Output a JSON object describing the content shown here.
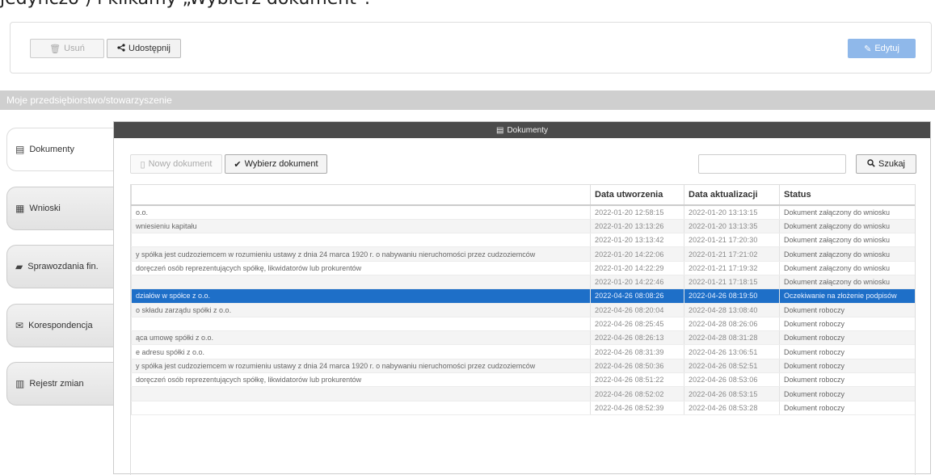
{
  "instruction_text": "jedynczo ) i klikamy „Wybierz dokument\".",
  "toolbar": {
    "delete_label": "Usuń",
    "share_label": "Udostępnij",
    "edit_label": "Edytuj"
  },
  "section_title": "Moje przedsiębiorstwo/stowarzyszenie",
  "sidebar": {
    "items": [
      {
        "label": "Dokumenty",
        "icon": "document-icon"
      },
      {
        "label": "Wnioski",
        "icon": "file-icon"
      },
      {
        "label": "Sprawozdania fin.",
        "icon": "folder-icon"
      },
      {
        "label": "Korespondencja",
        "icon": "envelope-icon"
      },
      {
        "label": "Rejestr zmian",
        "icon": "briefcase-icon"
      }
    ]
  },
  "documents_panel": {
    "title": "Dokumenty",
    "new_document_label": "Nowy dokument",
    "choose_document_label": "Wybierz dokument",
    "search_value": "",
    "search_button_label": "Szukaj"
  },
  "table": {
    "columns": [
      "",
      "Data utworzenia",
      "Data aktualizacji",
      "Status"
    ],
    "rows": [
      {
        "name": "o.o.",
        "created": "2022-01-20 12:58:15",
        "updated": "2022-01-20 13:13:15",
        "status": "Dokument załączony do wniosku"
      },
      {
        "name": "wniesieniu kapitału",
        "created": "2022-01-20 13:13:26",
        "updated": "2022-01-20 13:13:35",
        "status": "Dokument załączony do wniosku"
      },
      {
        "name": "",
        "created": "2022-01-20 13:13:42",
        "updated": "2022-01-21 17:20:30",
        "status": "Dokument załączony do wniosku"
      },
      {
        "name": "y spółka jest cudzoziemcem w rozumieniu ustawy z dnia 24 marca 1920 r. o nabywaniu nieruchomości przez cudzoziemców",
        "created": "2022-01-20 14:22:06",
        "updated": "2022-01-21 17:21:02",
        "status": "Dokument załączony do wniosku"
      },
      {
        "name": "doręczeń osób reprezentujących spółkę, likwidatorów lub prokurentów",
        "created": "2022-01-20 14:22:29",
        "updated": "2022-01-21 17:19:32",
        "status": "Dokument załączony do wniosku"
      },
      {
        "name": "",
        "created": "2022-01-20 14:22:46",
        "updated": "2022-01-21 17:18:15",
        "status": "Dokument załączony do wniosku"
      },
      {
        "name": "działów w spółce z o.o.",
        "created": "2022-04-26 08:08:26",
        "updated": "2022-04-26 08:19:50",
        "status": "Oczekiwanie na złożenie podpisów"
      },
      {
        "name": "o składu zarządu spółki z o.o.",
        "created": "2022-04-26 08:20:04",
        "updated": "2022-04-28 13:08:40",
        "status": "Dokument roboczy"
      },
      {
        "name": "",
        "created": "2022-04-26 08:25:45",
        "updated": "2022-04-28 08:26:06",
        "status": "Dokument roboczy"
      },
      {
        "name": "ąca umowę spółki z o.o.",
        "created": "2022-04-26 08:26:13",
        "updated": "2022-04-28 08:31:28",
        "status": "Dokument roboczy"
      },
      {
        "name": "e adresu spółki z o.o.",
        "created": "2022-04-26 08:31:39",
        "updated": "2022-04-26 13:06:51",
        "status": "Dokument roboczy"
      },
      {
        "name": "y spółka jest cudzoziemcem w rozumieniu ustawy z dnia 24 marca 1920 r. o nabywaniu nieruchomości przez cudzoziemców",
        "created": "2022-04-26 08:50:36",
        "updated": "2022-04-26 08:52:51",
        "status": "Dokument roboczy"
      },
      {
        "name": "doręczeń osób reprezentujących spółkę, likwidatorów lub prokurentów",
        "created": "2022-04-26 08:51:22",
        "updated": "2022-04-26 08:53:06",
        "status": "Dokument roboczy"
      },
      {
        "name": "",
        "created": "2022-04-26 08:52:02",
        "updated": "2022-04-26 08:53:15",
        "status": "Dokument roboczy"
      },
      {
        "name": "",
        "created": "2022-04-26 08:52:39",
        "updated": "2022-04-26 08:53:28",
        "status": "Dokument roboczy"
      }
    ],
    "selected_row": 6
  },
  "colors": {
    "selected_row": "#1e6fc8",
    "edit_button": "#8fb8ea",
    "panel_header": "#4b4b4b",
    "section_bar": "#cfcfcf"
  }
}
